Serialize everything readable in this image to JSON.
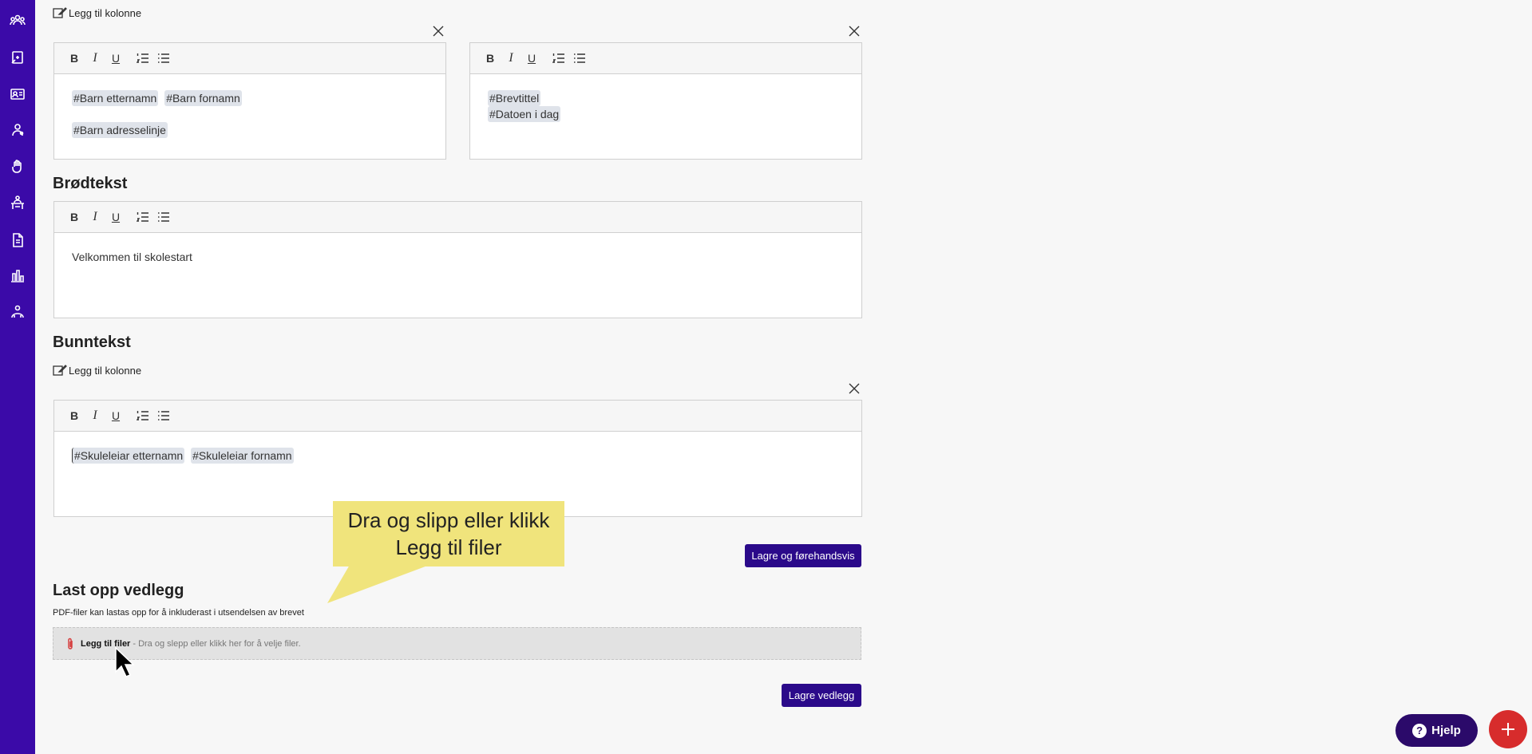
{
  "sidebar": {
    "icons": [
      "people-icon",
      "medical-icon",
      "card-icon",
      "person-settings-icon",
      "hand-icon",
      "desk-icon",
      "document-icon",
      "chart-icon",
      "network-icon"
    ]
  },
  "header_section": {
    "add_column_label": "Legg til kolonne",
    "left_editor": {
      "lines": [
        [
          "#Barn etternamn",
          "#Barn fornamn"
        ],
        [
          "#Barn adresselinje"
        ]
      ]
    },
    "right_editor": {
      "lines": [
        [
          "#Brevtittel"
        ],
        [
          "#Datoen i dag"
        ]
      ]
    }
  },
  "body_section": {
    "title": "Brødtekst",
    "text": "Velkommen til skolestart"
  },
  "footer_section": {
    "title": "Bunntekst",
    "add_column_label": "Legg til kolonne",
    "tags": [
      "#Skuleleiar etternamn",
      "#Skuleleiar fornamn"
    ]
  },
  "save_preview_label": "Lagre og førehandsvis",
  "callout": {
    "line1": "Dra og slipp eller klikk",
    "line2": "Legg til filer"
  },
  "attachments": {
    "title": "Last opp vedlegg",
    "description": "PDF-filer kan lastas opp for å inkluderast i utsendelsen av brevet",
    "upload_strong": "Legg til filer",
    "upload_hint": "- Dra og slepp eller klikk her for å velje filer.",
    "save_label": "Lagre vedlegg"
  },
  "help_label": "Hjelp",
  "colors": {
    "sidebar": "#3b0aa8",
    "primary": "#2b0a8a",
    "callout": "#f0e47c",
    "fab": "#d72c2c"
  }
}
